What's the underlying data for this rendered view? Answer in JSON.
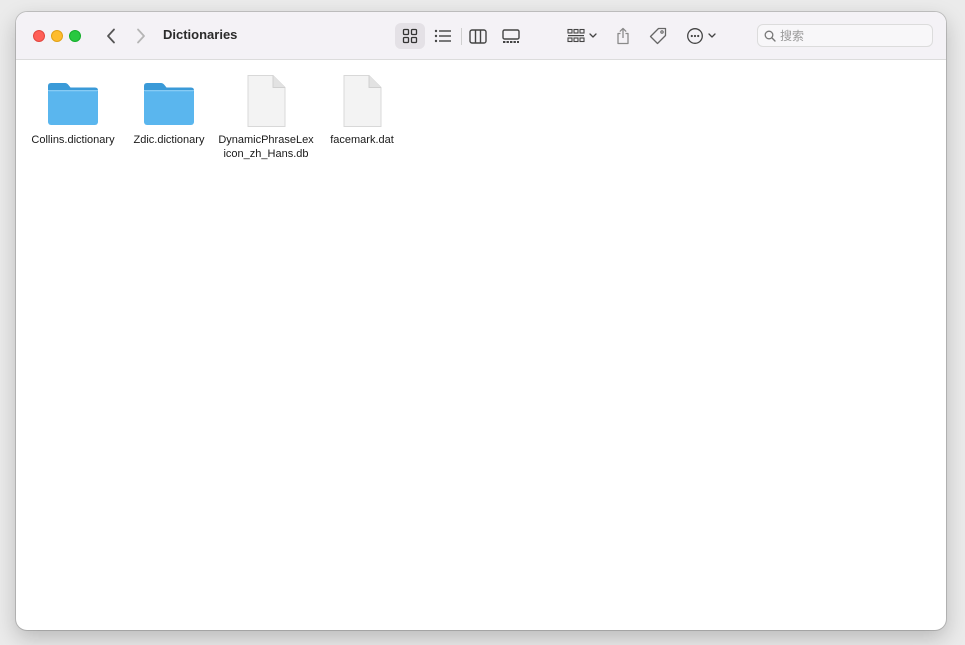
{
  "window": {
    "title": "Dictionaries"
  },
  "toolbar": {
    "icons": {
      "back": "chevron-left-icon",
      "forward": "chevron-right-icon",
      "view_icons": "grid-icon",
      "view_list": "list-icon",
      "view_columns": "columns-icon",
      "view_gallery": "gallery-icon",
      "group": "group-grid-icon",
      "share": "share-icon",
      "tag": "tag-icon",
      "more": "ellipsis-circle-icon"
    },
    "search": {
      "value": "",
      "placeholder": "搜索"
    }
  },
  "files": [
    {
      "name": "Collins.dictionary",
      "kind": "folder"
    },
    {
      "name": "Zdic.dictionary",
      "kind": "folder"
    },
    {
      "name": "DynamicPhraseLexicon_zh_Hans.db",
      "kind": "document"
    },
    {
      "name": "facemark.dat",
      "kind": "document"
    }
  ],
  "colors": {
    "folder": "#5ab6ee",
    "folder_tab": "#3a9ad8",
    "close": "#ff5f57",
    "minimize": "#febc2e",
    "maximize": "#28c840",
    "toolbar_bg": "#f4f2f6"
  }
}
